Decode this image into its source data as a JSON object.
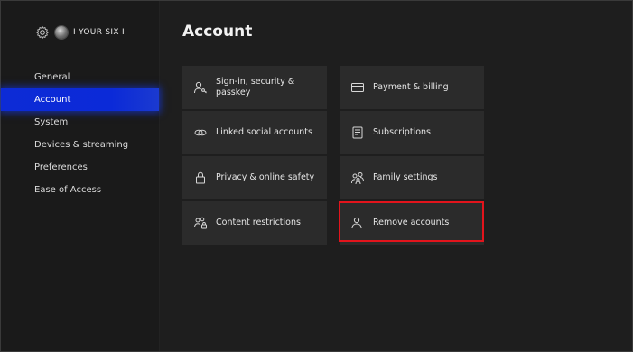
{
  "profile": {
    "gamertag": "I YOUR SIX I"
  },
  "sidebar": {
    "items": [
      {
        "label": "General",
        "active": false
      },
      {
        "label": "Account",
        "active": true
      },
      {
        "label": "System",
        "active": false
      },
      {
        "label": "Devices & streaming",
        "active": false
      },
      {
        "label": "Preferences",
        "active": false
      },
      {
        "label": "Ease of Access",
        "active": false
      }
    ]
  },
  "main": {
    "title": "Account",
    "tiles": [
      {
        "label": "Sign-in, security & passkey",
        "icon": "person-key-icon"
      },
      {
        "label": "Payment & billing",
        "icon": "card-icon"
      },
      {
        "label": "Linked social accounts",
        "icon": "link-icon"
      },
      {
        "label": "Subscriptions",
        "icon": "document-icon"
      },
      {
        "label": "Privacy & online safety",
        "icon": "lock-icon"
      },
      {
        "label": "Family settings",
        "icon": "family-icon"
      },
      {
        "label": "Content restrictions",
        "icon": "people-lock-icon"
      },
      {
        "label": "Remove accounts",
        "icon": "person-icon"
      }
    ]
  },
  "colors": {
    "accent": "#0d2bd6",
    "highlight": "#e2141c"
  }
}
